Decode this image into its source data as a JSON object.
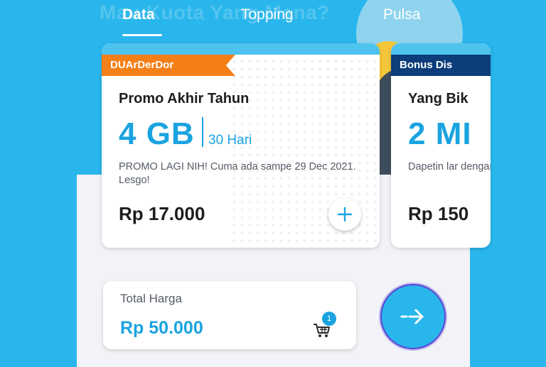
{
  "background_headline": "Mau Kuota Yang Mana?",
  "tabs": [
    {
      "label": "Data",
      "active": true
    },
    {
      "label": "Topping",
      "active": false
    },
    {
      "label": "Pulsa",
      "active": false
    }
  ],
  "packages": [
    {
      "ribbon": "DUArDerDor",
      "ribbon_color": "#f57f17",
      "title": "Promo Akhir Tahun",
      "quota": "4 GB",
      "duration": "30 Hari",
      "description": "PROMO LAGI NIH! Cuma ada sampe 29 Dec 2021. Lesgo!",
      "price": "Rp 17.000",
      "add_icon": "plus-icon"
    },
    {
      "ribbon": "Bonus Dis",
      "ribbon_color": "#0d3d7a",
      "title": "Yang Bik",
      "quota": "2 MI",
      "description": "Dapetin lar dengan me",
      "price": "Rp 150"
    }
  ],
  "total": {
    "label": "Total Harga",
    "value": "Rp 50.000",
    "cart_icon": "cart-icon",
    "cart_count": "1"
  },
  "next_icon": "arrow-right-icon",
  "colors": {
    "primary": "#29b6ec",
    "accent_text": "#1aa3e0",
    "orange": "#f57f17",
    "navy": "#0d3d7a",
    "next_border": "#5a45d6"
  }
}
